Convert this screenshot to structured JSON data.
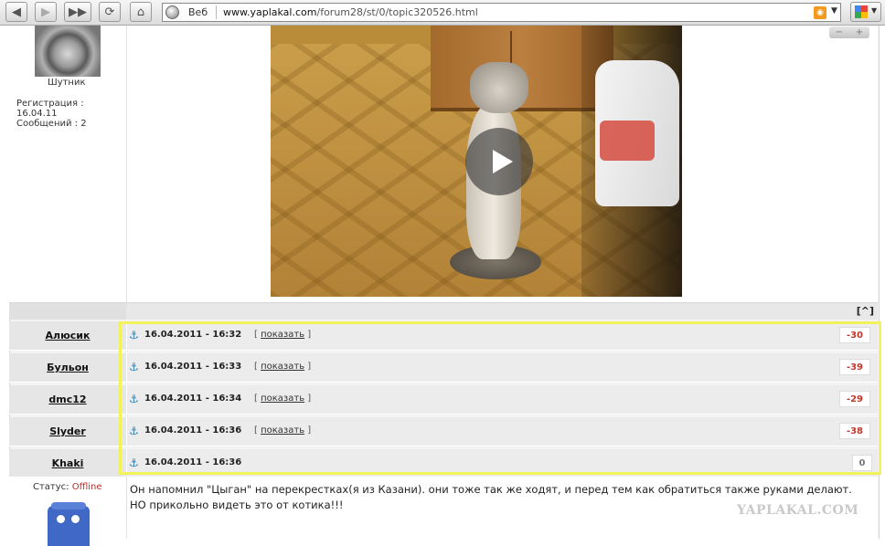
{
  "browser": {
    "search_label": "Веб",
    "url_domain": "www.yaplakal.com",
    "url_path": "/forum28/st/0/topic320526.html",
    "rss_label": "RSS"
  },
  "post1": {
    "username": "Шутник",
    "reg_label": "Регистрация :",
    "reg_date": "16.04.11",
    "messages_label": "Сообщений : 2",
    "zoom_minus": "−",
    "zoom_plus": "+"
  },
  "to_top": "[^]",
  "rows": [
    {
      "nick": "Алюсик",
      "datetime": "16.04.2011 - 16:32",
      "show_label": "показать",
      "score": "-30"
    },
    {
      "nick": "Бульон",
      "datetime": "16.04.2011 - 16:33",
      "show_label": "показать",
      "score": "-39"
    },
    {
      "nick": "dmc12",
      "datetime": "16.04.2011 - 16:34",
      "show_label": "показать",
      "score": "-29"
    },
    {
      "nick": "Slyder",
      "datetime": "16.04.2011 - 16:36",
      "show_label": "показать",
      "score": "-38"
    },
    {
      "nick": "Khaki",
      "datetime": "16.04.2011 - 16:36",
      "score": "0"
    }
  ],
  "post2": {
    "status_label": "Статус:",
    "status_value": "Offline",
    "comment": "Он напомнил \"Цыган\" на перекрестках(я из Казани). они тоже так же ходят, и перед тем как обратиться также руками делают. НО прикольно видеть это от котика!!!",
    "watermark": "YAPLAKAL.COM"
  },
  "colors": {
    "highlight": "#f2f25a",
    "score_negative": "#c0392b",
    "offline": "#b03030"
  }
}
